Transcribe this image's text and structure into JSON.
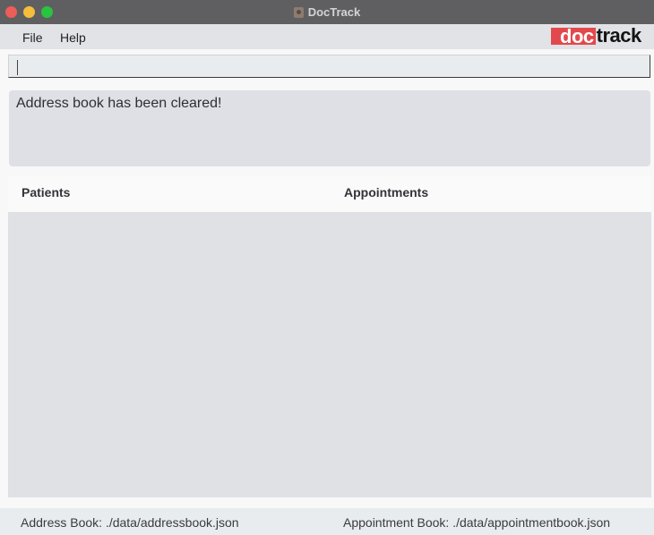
{
  "window": {
    "title": "DocTrack"
  },
  "menu": {
    "file": "File",
    "help": "Help"
  },
  "logo": {
    "part1": "doc",
    "part2": "track",
    "accent": "#e3494c"
  },
  "command": {
    "value": "",
    "placeholder": ""
  },
  "result": {
    "message": "Address book has been cleared!"
  },
  "panels": {
    "patients_header": "Patients",
    "appointments_header": "Appointments"
  },
  "status": {
    "address_book": "Address Book: ./data/addressbook.json",
    "appointment_book": "Appointment Book: ./data/appointmentbook.json"
  }
}
